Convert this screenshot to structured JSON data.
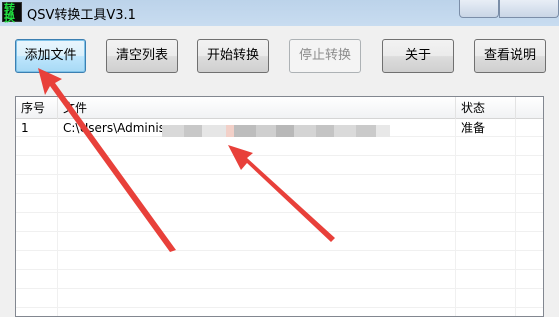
{
  "window": {
    "title": "QSV转换工具V3.1",
    "icon": "app-logo-icon"
  },
  "toolbar": {
    "add_file": "添加文件",
    "clear_list": "清空列表",
    "start_convert": "开始转换",
    "stop_convert": "停止转换",
    "about": "关于",
    "view_help": "查看说明"
  },
  "list": {
    "columns": [
      "序号",
      "文件",
      "状态"
    ],
    "rows": [
      {
        "index": "1",
        "file": "C:\\Users\\Administr",
        "status": "准备"
      }
    ]
  },
  "colors": {
    "annotation_arrow": "#e8403a",
    "titlebar": "#c3d8ee"
  },
  "annotations": {
    "arrows": [
      "arrow-to-add-file-button",
      "arrow-to-file-path"
    ]
  }
}
